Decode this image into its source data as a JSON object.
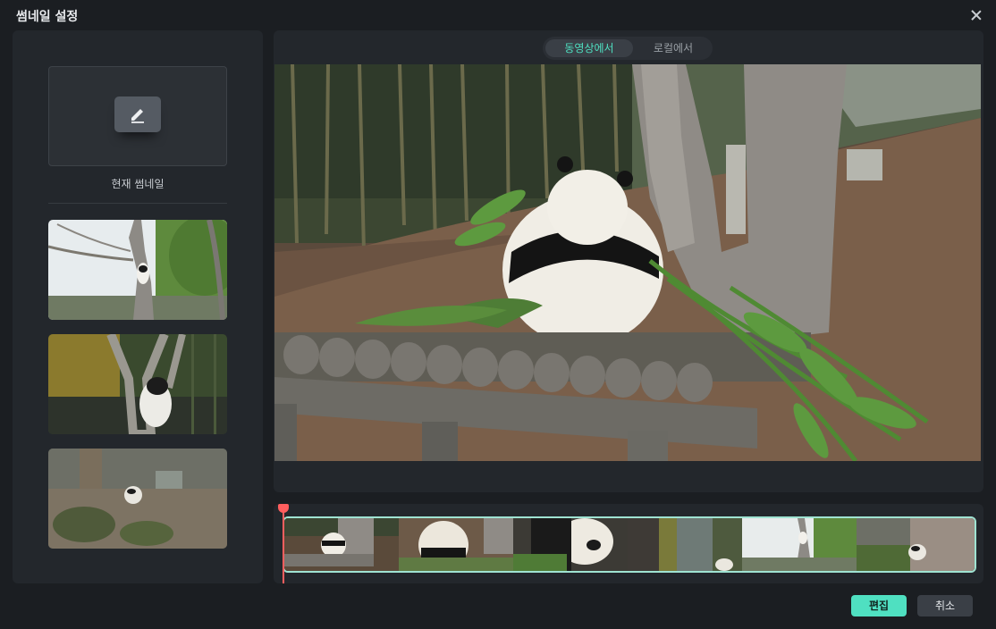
{
  "window": {
    "title": "썸네일 설정"
  },
  "left": {
    "current_label": "현재 썸네일",
    "edit_icon": "pencil-icon",
    "thumbnails": [
      {
        "subject": "panda climbing bare tree"
      },
      {
        "subject": "panda climbing tree among bamboo"
      },
      {
        "subject": "panda in enclosure"
      }
    ]
  },
  "tabs": [
    {
      "label": "동영상에서",
      "active": true
    },
    {
      "label": "로컬에서",
      "active": false
    }
  ],
  "timeline": {
    "playhead_color": "#ff5e5e",
    "strip_border_color": "#9fe3d2"
  },
  "footer": {
    "edit_label": "편집",
    "cancel_label": "취소"
  },
  "colors": {
    "accent": "#4fe0c1",
    "background": "#1b1e22",
    "panel": "#23272c"
  }
}
